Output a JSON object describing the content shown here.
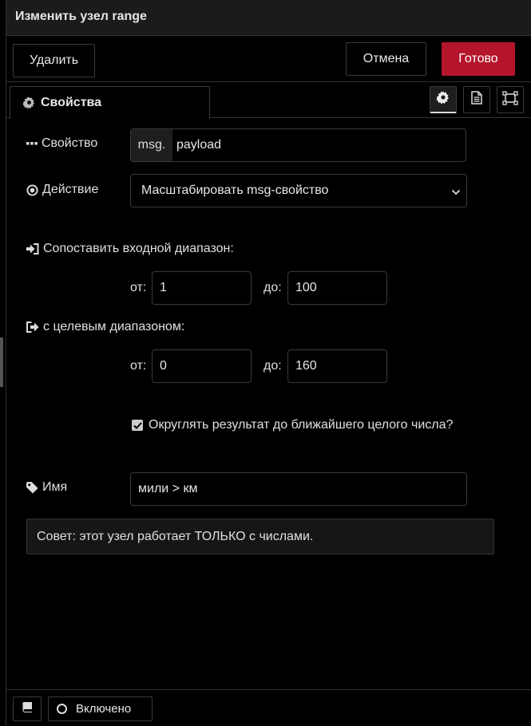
{
  "dialog": {
    "title": "Изменить узел range"
  },
  "toolbar": {
    "delete_label": "Удалить",
    "cancel_label": "Отмена",
    "done_label": "Готово",
    "done_color": "#b5152b"
  },
  "tabs": {
    "properties_label": "Свойства"
  },
  "form": {
    "property": {
      "label": "Свойство",
      "prefix": "msg.",
      "value": "payload"
    },
    "action": {
      "label": "Действие",
      "selected": "Масштабировать msg-свойство"
    },
    "input_range": {
      "label": "Сопоставить входной диапазон:",
      "from_label": "от:",
      "from_value": "1",
      "to_label": "до:",
      "to_value": "100"
    },
    "target_range": {
      "label": "с целевым диапазоном:",
      "from_label": "от:",
      "from_value": "0",
      "to_label": "до:",
      "to_value": "160"
    },
    "round": {
      "label": "Округлять результат до ближайшего целого числа?",
      "checked": true
    },
    "name": {
      "label": "Имя",
      "value": "мили > км"
    },
    "tip": "Совет: этот узел работает ТОЛЬКО с числами."
  },
  "footer": {
    "enabled_label": "Включено"
  },
  "icons": [
    "gear-icon",
    "file-text-icon",
    "frame-icon",
    "ellipsis-icon",
    "dot-circle-icon",
    "sign-in-icon",
    "sign-out-icon",
    "tag-icon",
    "book-icon",
    "chevron-down-icon",
    "check-icon",
    "circle-icon"
  ]
}
